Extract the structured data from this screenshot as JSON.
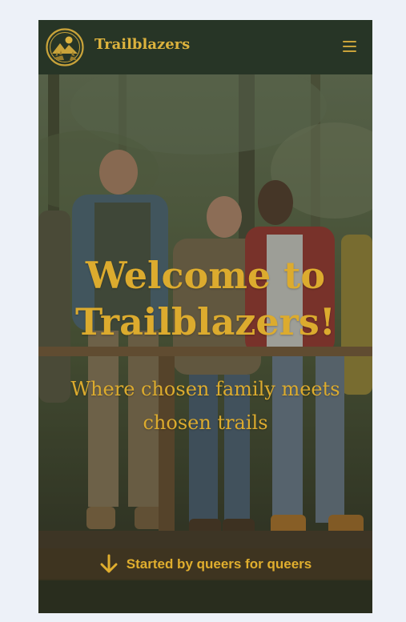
{
  "navbar": {
    "brand": "Trailblazers",
    "logo_icon": "mountain-sun-trees-logo",
    "menu_icon": "hamburger-menu-icon"
  },
  "hero": {
    "title": "Welcome to Trailblazers!",
    "subtitle": "Where chosen family meets chosen trails",
    "banner_icon": "arrow-down-icon",
    "banner_text": "Started by queers for queers"
  },
  "colors": {
    "navbar_bg": "#273526",
    "accent_gold": "#dcab2e",
    "page_bg": "#edf1f8"
  }
}
